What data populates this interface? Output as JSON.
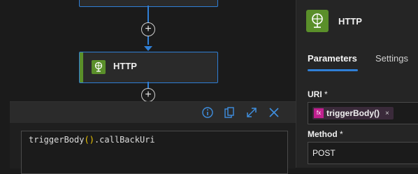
{
  "canvas": {
    "nodes": [
      {
        "label": "HTTP",
        "selected": true
      }
    ],
    "add_step_symbol": "+"
  },
  "editor": {
    "toolbar_icons": [
      "info-icon",
      "clipboard-icon",
      "expand-icon",
      "close-icon"
    ],
    "code": {
      "before": "triggerBody",
      "open": "(",
      "close": ")",
      "after": ".callBackUri"
    }
  },
  "panel": {
    "title": "HTTP",
    "tabs": [
      {
        "label": "Parameters",
        "active": true
      },
      {
        "label": "Settings",
        "active": false
      }
    ],
    "fields": {
      "uri": {
        "label": "URI",
        "required_marker": "*",
        "token_prefix": "fx",
        "token_text": "triggerBody()",
        "token_remove": "×"
      },
      "method": {
        "label": "Method",
        "required_marker": "*",
        "value": "POST"
      }
    }
  },
  "colors": {
    "accent": "#2f7fd6",
    "http_green": "#5a8f2a",
    "fx_magenta": "#c01f8f",
    "paren_yellow": "#f0c800"
  }
}
